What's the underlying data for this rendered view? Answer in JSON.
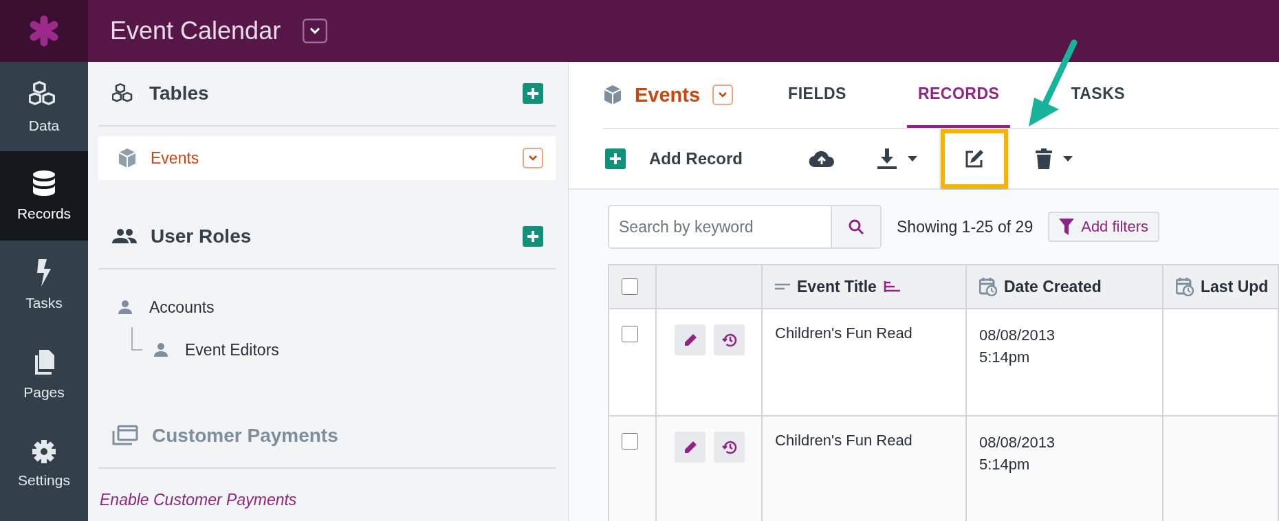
{
  "app": {
    "title": "Event Calendar"
  },
  "nav": [
    {
      "label": "Data",
      "kind": "data",
      "selected": false
    },
    {
      "label": "Records",
      "kind": "records",
      "selected": true
    },
    {
      "label": "Tasks",
      "kind": "tasks",
      "selected": false
    },
    {
      "label": "Pages",
      "kind": "pages",
      "selected": false
    },
    {
      "label": "Settings",
      "kind": "settings",
      "selected": false
    }
  ],
  "sidebar": {
    "tables": {
      "title": "Tables",
      "items": [
        {
          "label": "Events",
          "selected": true
        }
      ]
    },
    "user_roles": {
      "title": "User Roles",
      "items": [
        {
          "label": "Accounts",
          "children": [
            {
              "label": "Event Editors"
            }
          ]
        }
      ]
    },
    "payments": {
      "title": "Customer Payments",
      "disabled": true,
      "link": "Enable Customer Payments"
    }
  },
  "main": {
    "object_title": "Events",
    "tabs": [
      {
        "label": "FIELDS",
        "selected": false
      },
      {
        "label": "RECORDS",
        "selected": true
      },
      {
        "label": "TASKS",
        "selected": false
      }
    ],
    "toolbar": {
      "add_label": "Add Record"
    },
    "search": {
      "placeholder": "Search by keyword"
    },
    "showing": "Showing 1-25 of 29",
    "filter_button": "Add filters",
    "table": {
      "header_checked": false,
      "columns": [
        {
          "label": "Event Title",
          "kind": "text",
          "sorted": true
        },
        {
          "label": "Date Created",
          "kind": "date",
          "sorted": false
        },
        {
          "label": "Last Upd",
          "kind": "date",
          "sorted": false
        }
      ],
      "rows": [
        {
          "checked": false,
          "title": "Children's Fun Read",
          "date_created": "08/08/2013 5:14pm"
        },
        {
          "checked": false,
          "title": "Children's Fun Read",
          "date_created": "08/08/2013 5:14pm"
        }
      ]
    }
  }
}
